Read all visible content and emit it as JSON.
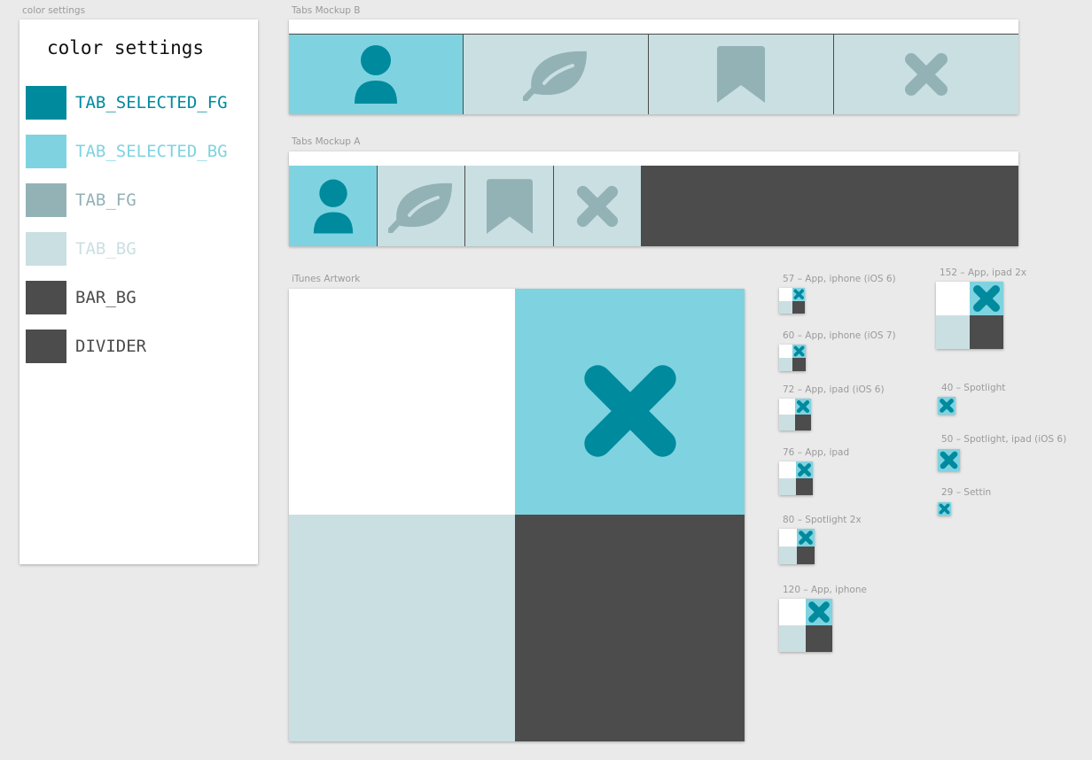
{
  "colors": {
    "tab_selected_fg": "#008a9e",
    "tab_selected_bg": "#7fd3e0",
    "tab_fg": "#93b2b6",
    "tab_bg": "#cadfe2",
    "bar_bg": "#4c4c4c",
    "divider": "#4c4c4c"
  },
  "color_settings": {
    "artboard_label": "color settings",
    "title": "color settings",
    "swatches": [
      {
        "name": "TAB_SELECTED_FG",
        "color": "#008a9e"
      },
      {
        "name": "TAB_SELECTED_BG",
        "color": "#7fd3e0"
      },
      {
        "name": "TAB_FG",
        "color": "#93b2b6"
      },
      {
        "name": "TAB_BG",
        "color": "#cadfe2"
      },
      {
        "name": "BAR_BG",
        "color": "#4c4c4c"
      },
      {
        "name": "DIVIDER",
        "color": "#4c4c4c"
      }
    ]
  },
  "tabs_mockup_b": {
    "label": "Tabs Mockup B",
    "tabs": [
      {
        "icon": "person-icon",
        "selected": true
      },
      {
        "icon": "leaf-icon",
        "selected": false
      },
      {
        "icon": "bookmark-icon",
        "selected": false
      },
      {
        "icon": "close-x-icon",
        "selected": false
      }
    ]
  },
  "tabs_mockup_a": {
    "label": "Tabs Mockup A",
    "tabs": [
      {
        "icon": "person-icon",
        "selected": true
      },
      {
        "icon": "leaf-icon",
        "selected": false
      },
      {
        "icon": "bookmark-icon",
        "selected": false
      },
      {
        "icon": "close-x-icon",
        "selected": false
      }
    ]
  },
  "itunes_artwork": {
    "label": "iTunes Artwork",
    "icon": "close-x-icon"
  },
  "icon_sizes": [
    {
      "label": "57 – App, iphone (iOS 6)",
      "kind": "app"
    },
    {
      "label": "60 – App, iphone (iOS 7)",
      "kind": "app"
    },
    {
      "label": "72 – App, ipad (iOS 6)",
      "kind": "app"
    },
    {
      "label": "76 – App, ipad",
      "kind": "app"
    },
    {
      "label": "80 – Spotlight 2x",
      "kind": "app"
    },
    {
      "label": "120 – App, iphone",
      "kind": "app"
    },
    {
      "label": "152 – App, ipad 2x",
      "kind": "app"
    },
    {
      "label": "40 – Spotlight",
      "kind": "spotlight"
    },
    {
      "label": "50 – Spotlight, ipad (iOS 6)",
      "kind": "spotlight"
    },
    {
      "label": "29 – Settin",
      "kind": "spotlight"
    }
  ]
}
